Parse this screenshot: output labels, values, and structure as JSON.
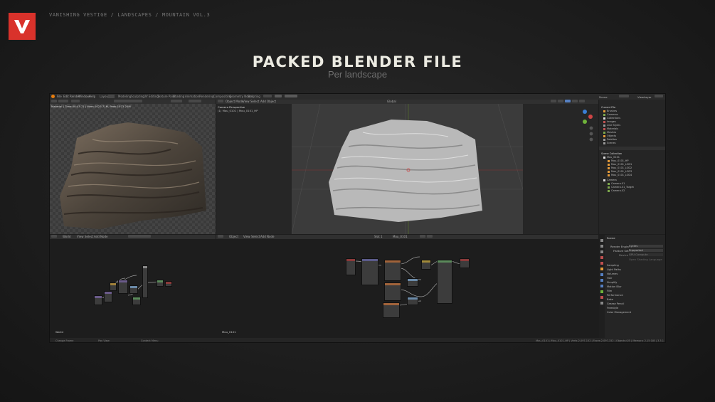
{
  "breadcrumb": "VANISHING VESTIGE / LANDSCAPES / MOUNTAIN VOL.3",
  "title": "PACKED BLENDER FILE",
  "subtitle": "Per landscape",
  "colors": {
    "accent": "#d9322b",
    "background": "#1e1e1e",
    "title": "#ecebe2",
    "subtitle": "#6f6f6f"
  },
  "blender": {
    "menus": [
      "File",
      "Edit",
      "Render",
      "Window",
      "Help"
    ],
    "workspaces": [
      "Layout",
      "Modeling",
      "Sculpting",
      "UV Editing",
      "Texture Paint",
      "Shading",
      "Animation",
      "Rendering",
      "Compositing",
      "Geometry Nodes",
      "Scripting"
    ],
    "active_workspace": "Layout",
    "scene": "Scene",
    "view_layer": "ViewLayer",
    "image_editor_info": "Material | Time:00:43.71 | Mem:1023.71M, Peak:1073.20M",
    "viewport_title": "Camera Perspective",
    "viewport_subtitle": "(1) Mou_0101 | Mou_0101_HP",
    "viewport_mode": "Object Mode",
    "viewport_menus": [
      "View",
      "Select",
      "Add",
      "Object"
    ],
    "transform": "Global",
    "outliner": {
      "root": "Current File",
      "categories": [
        "Brushes",
        "Cameras",
        "Collections",
        "Images",
        "Line Styles",
        "Materials",
        "Meshes",
        "Objects",
        "Palettes",
        "Scenes"
      ],
      "collection": "Scene Collection",
      "items": [
        "Mou_0101",
        "Mou_0101_HP",
        "Mou_0101_LOD1",
        "Mou_0101_LOD2",
        "Mou_0101_LOD3",
        "Mou_0101_LOD4",
        "Camera",
        "Camera.01",
        "Camera.01_Target",
        "Camera.02"
      ]
    },
    "properties": {
      "header": "Scene",
      "render_engine_label": "Render Engine",
      "render_engine": "Cycles",
      "feature_set_label": "Feature Set",
      "feature_set": "Supported",
      "device_label": "Device",
      "device": "GPU Compute",
      "note": "Open Shading Language",
      "sections": [
        "Sampling",
        "Light Paths",
        "Volumes",
        "Hair",
        "Simplify",
        "Motion Blur",
        "Film",
        "Performance",
        "Bake",
        "Grease Pencil",
        "Freestyle",
        "Color Management"
      ]
    },
    "node_left": {
      "mode": "World",
      "menus": [
        "View",
        "Select",
        "Add",
        "Node"
      ],
      "label": "World"
    },
    "node_right": {
      "mode": "Object",
      "menus": [
        "View",
        "Select",
        "Add",
        "Node"
      ],
      "slot": "Slot 1",
      "material": "Mou_0101",
      "label": "Mou_0101"
    },
    "status": {
      "left1": "Change Frame",
      "left2": "Pan View",
      "left3": "Context Menu",
      "right": "Mou_0101 | Mou_0101_HP | Verts:2,097,152 | Faces:2,097,152 | Objects:0/5 | Memory: 2.15 GiB | 3.3.1"
    }
  }
}
